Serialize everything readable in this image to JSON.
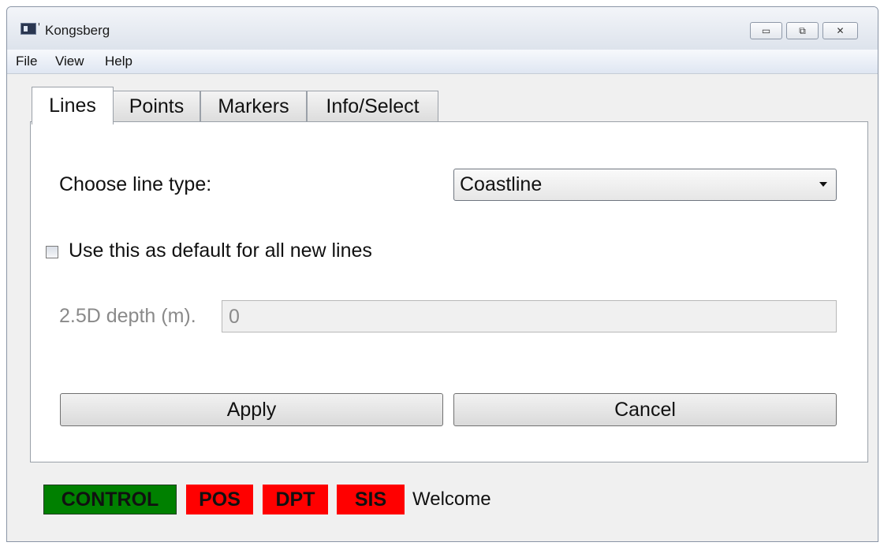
{
  "window": {
    "title": "Kongsberg",
    "controls": {
      "minimize": "▭",
      "maximize": "⧉",
      "close": "✕"
    }
  },
  "menu": {
    "items": [
      "File",
      "View",
      "Help"
    ]
  },
  "tabs": [
    {
      "label": "Lines",
      "active": true
    },
    {
      "label": "Points",
      "active": false
    },
    {
      "label": "Markers",
      "active": false
    },
    {
      "label": "Info/Select",
      "active": false
    }
  ],
  "lines_tab": {
    "line_type_label": "Choose line type:",
    "line_type_value": "Coastline",
    "default_checkbox_label": "Use this as default for all new lines",
    "default_checked": false,
    "depth_label": "2.5D depth (m).",
    "depth_value": "0",
    "apply_label": "Apply",
    "cancel_label": "Cancel"
  },
  "status_bar": {
    "indicators": [
      {
        "label": "CONTROL",
        "color": "#008000"
      },
      {
        "label": "POS",
        "color": "#ff0000"
      },
      {
        "label": "DPT",
        "color": "#ff0000"
      },
      {
        "label": "SIS",
        "color": "#ff0000"
      }
    ],
    "message": "Welcome"
  }
}
